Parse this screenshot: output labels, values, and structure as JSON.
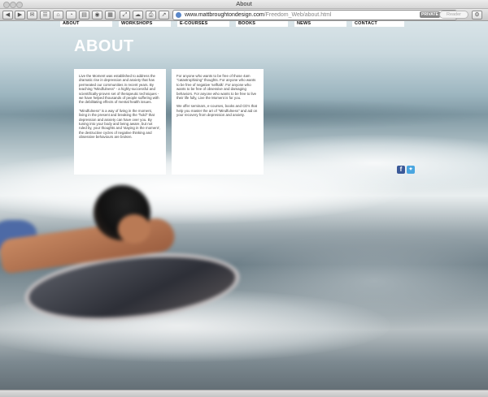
{
  "window": {
    "title": "About"
  },
  "browser": {
    "url_host": "www.mattbroughtondesign.com",
    "url_path": "/Freedom_Web/about.html",
    "private_badge": "PRIVATE",
    "reader_label": "Reader"
  },
  "nav": {
    "items": [
      {
        "label": "ABOUT"
      },
      {
        "label": "WORKSHOPS"
      },
      {
        "label": "E-COURSES"
      },
      {
        "label": "BOOKS"
      },
      {
        "label": "NEWS"
      },
      {
        "label": "CONTACT"
      }
    ]
  },
  "content": {
    "heading": "ABOUT",
    "left_panel": {
      "p1": "Live the Moment was established to address the dramatic rise in depression and anxiety that has permeated our communities in recent years. By teaching \"Mindfulness\" - a highly-successful and scientifically-proven set of therapeutic techniques - we have helped thousands of people suffering with the debilitating effects of mental health issues.",
      "p2": "\"Mindfulness\" is a way of living in the moment, living in the present and breaking the \"hold\" that depression and anxiety can have over you. By tuning into your body and being aware, but not ruled by, your thoughts and 'staying in the moment', the destructive cycles of negative thinking and obsessive behaviours are broken."
    },
    "right_panel": {
      "p1": "For anyone who wants to be free of those 4am \"catastrophising\" thoughts. For anyone who wants to be free of negative 'selftalk'. For anyone who wants to be free of obsessive and damaging behaviors. For anyone who wants to be free to live their life fully, Live the Moment is for you.",
      "p2": "We offer seminars, e-courses, books and CD's that help you master the art of \"Mindfulness\" and aid on your recovery from depression and anxiety."
    }
  },
  "social": {
    "icons": [
      "facebook-icon",
      "twitter-icon"
    ]
  },
  "colors": {
    "facebook": "#3b5998",
    "twitter": "#4aa6e0",
    "heading": "#ffffff",
    "panel_bg": "#ffffff"
  }
}
